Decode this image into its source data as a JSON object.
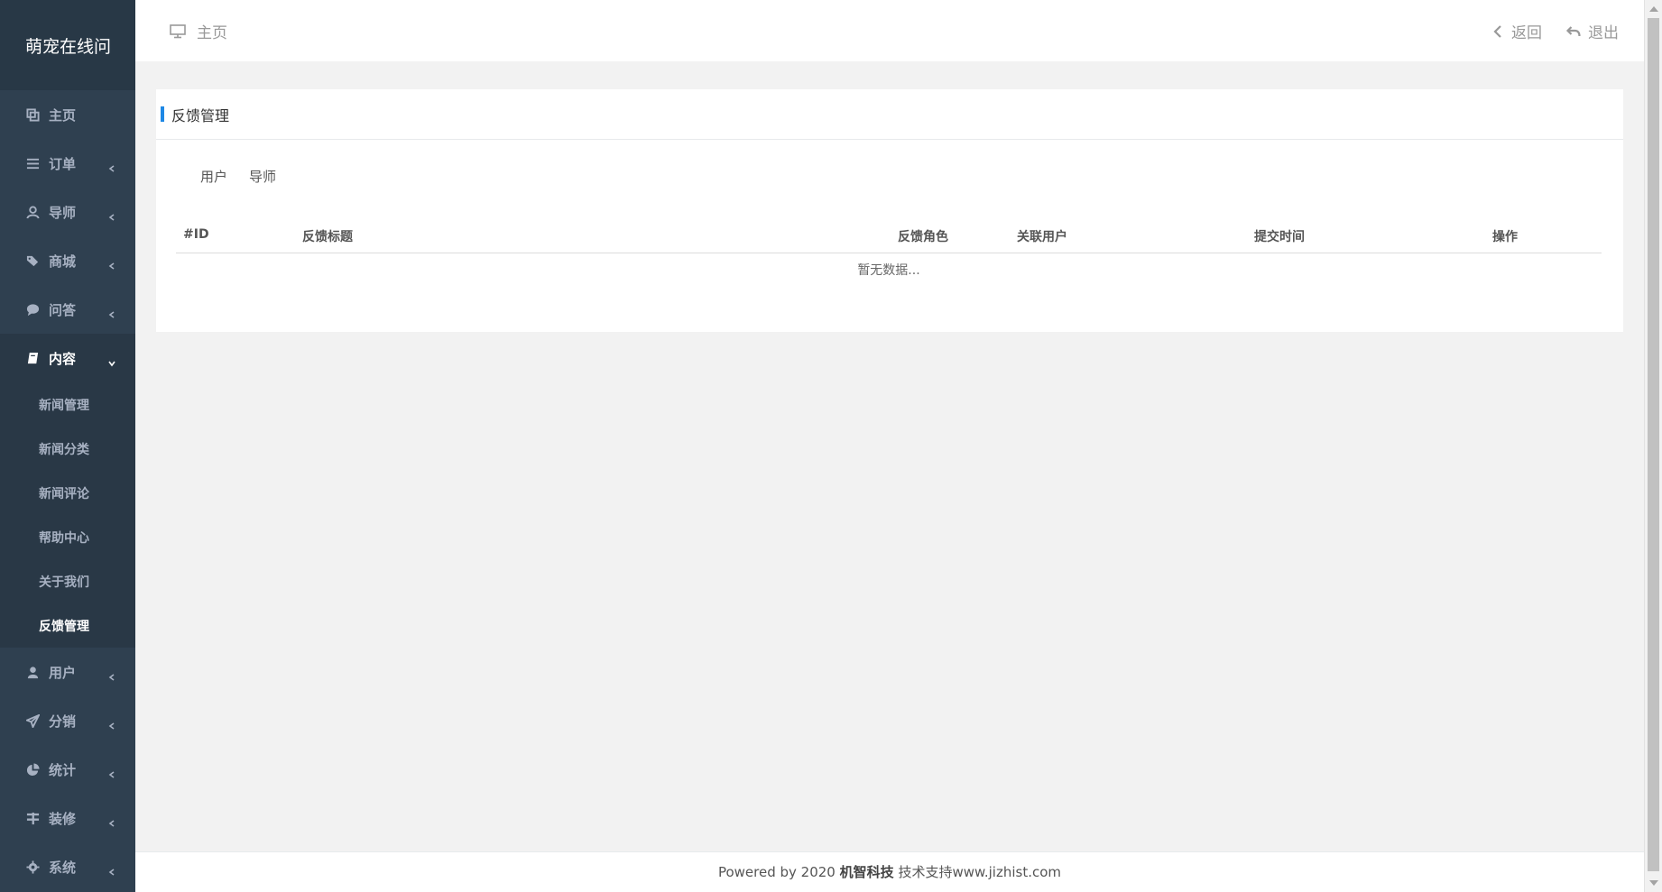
{
  "brand": "萌宠在线问",
  "sidebar": {
    "items": [
      {
        "label": "主页",
        "icon": "copy-icon"
      },
      {
        "label": "订单",
        "icon": "list-icon"
      },
      {
        "label": "导师",
        "icon": "user-outline-icon"
      },
      {
        "label": "商城",
        "icon": "tags-icon"
      },
      {
        "label": "问答",
        "icon": "comment-icon"
      },
      {
        "label": "内容",
        "icon": "book-icon"
      },
      {
        "label": "用户",
        "icon": "user-icon"
      },
      {
        "label": "分销",
        "icon": "paper-plane-icon"
      },
      {
        "label": "统计",
        "icon": "pie-chart-icon"
      },
      {
        "label": "装修",
        "icon": "paint-icon"
      },
      {
        "label": "系统",
        "icon": "gear-icon"
      }
    ],
    "content_submenu": [
      "新闻管理",
      "新闻分类",
      "新闻评论",
      "帮助中心",
      "关于我们",
      "反馈管理"
    ],
    "active_submenu": "反馈管理"
  },
  "topbar": {
    "home_tab": "主页",
    "back_label": "返回",
    "logout_label": "退出"
  },
  "panel": {
    "title": "反馈管理",
    "tabs": [
      "用户",
      "导师"
    ],
    "columns": [
      "#ID",
      "反馈标题",
      "反馈角色",
      "关联用户",
      "提交时间",
      "操作"
    ],
    "empty_text": "暂无数据..."
  },
  "footer": {
    "prefix": "Powered by 2020",
    "company": "机智科技",
    "suffix": "技术支持www.jizhist.com"
  },
  "colors": {
    "sidebar_bg": "#2f4050",
    "accent": "#1e88e5"
  }
}
